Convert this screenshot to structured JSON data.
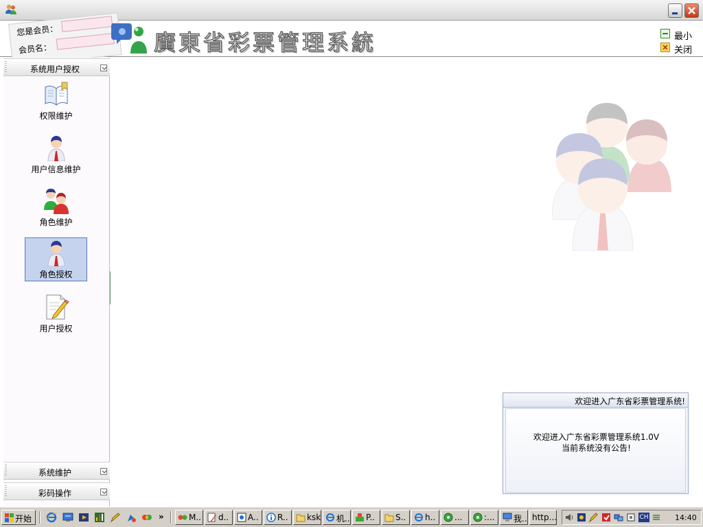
{
  "titlebar": {
    "app_icon": "users-icon",
    "minimize_icon": "minimize-icon",
    "close_icon": "close-icon"
  },
  "header": {
    "member_label": "您是会员：",
    "member_name_label": "会员名：",
    "title": "廣東省彩票管理系統",
    "minimize_label": "最小",
    "close_label": "关闭"
  },
  "sidebar": {
    "sections": [
      {
        "label": "系统用户授权"
      },
      {
        "label": "系统维护"
      },
      {
        "label": "彩码操作"
      }
    ],
    "items": [
      {
        "label": "权限维护",
        "icon": "open-book-icon"
      },
      {
        "label": "用户信息维护",
        "icon": "user-icon"
      },
      {
        "label": "角色维护",
        "icon": "user-group-icon"
      },
      {
        "label": "角色授权",
        "icon": "user-icon",
        "selected": true
      },
      {
        "label": "用户授权",
        "icon": "document-pencil-icon"
      }
    ]
  },
  "notice": {
    "title": "欢迎进入广东省彩票管理系统!",
    "line1": "欢迎进入广东省彩票管理系统1.0V",
    "line2": "当前系统没有公告!"
  },
  "taskbar": {
    "start_label": "开始",
    "tasks": [
      {
        "label": "M..",
        "icon": "browser-icon"
      },
      {
        "label": "d..",
        "icon": "editor-icon"
      },
      {
        "label": "A..",
        "icon": "app-icon"
      },
      {
        "label": "R..",
        "icon": "info-icon"
      },
      {
        "label": "ksk",
        "icon": "folder-icon"
      },
      {
        "label": "机..",
        "icon": "ie-icon"
      },
      {
        "label": "P..",
        "icon": "tools-icon"
      },
      {
        "label": "S..",
        "icon": "folder-icon"
      },
      {
        "label": "h..",
        "icon": "ie-icon"
      },
      {
        "label": "...",
        "icon": "cd-icon"
      },
      {
        "label": ":...",
        "icon": "cd-icon"
      },
      {
        "label": "我..",
        "icon": "computer-icon"
      },
      {
        "label": "http...",
        "icon": ""
      }
    ],
    "clock": "14:40",
    "ime": "CH"
  }
}
